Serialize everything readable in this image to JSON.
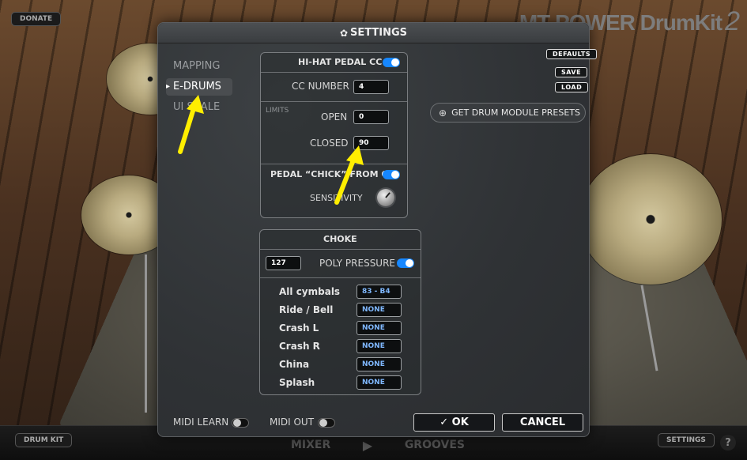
{
  "app": {
    "logo": "MT POWER DrumKit",
    "logo_version": "2",
    "donate_label": "DONATE",
    "drum_kit_label": "DRUM KIT",
    "settings_label": "SETTINGS",
    "mixer_label": "MIXER",
    "grooves_label": "GROOVES",
    "help_label": "?"
  },
  "dialog": {
    "title": "SETTINGS",
    "nav": [
      {
        "label": "MAPPING",
        "active": false
      },
      {
        "label": "E-DRUMS",
        "active": true
      },
      {
        "label": "UI SCALE",
        "active": false
      }
    ],
    "defaults_label": "DEFAULTS",
    "save_label": "SAVE",
    "load_label": "LOAD",
    "preset_button_label": "GET DRUM MODULE PRESETS",
    "hihat": {
      "title": "HI-HAT PEDAL CC",
      "enabled": true,
      "cc_number_label": "CC NUMBER",
      "cc_number_value": "4",
      "limits_label": "LIMITS",
      "open_label": "OPEN",
      "open_value": "0",
      "closed_label": "CLOSED",
      "closed_value": "90",
      "pedal_chick_label": "PEDAL “CHICK” FROM CC",
      "pedal_chick_enabled": true,
      "sensitivity_label": "SENSITIVITY"
    },
    "choke": {
      "title": "CHOKE",
      "value": "127",
      "poly_pressure_label": "POLY PRESSURE",
      "poly_pressure_enabled": true,
      "rows": [
        {
          "label": "All  cymbals",
          "value": "83 - B4"
        },
        {
          "label": "Ride / Bell",
          "value": "NONE"
        },
        {
          "label": "Crash L",
          "value": "NONE"
        },
        {
          "label": "Crash R",
          "value": "NONE"
        },
        {
          "label": "China",
          "value": "NONE"
        },
        {
          "label": "Splash",
          "value": "NONE"
        }
      ]
    },
    "midi_learn_label": "MIDI LEARN",
    "midi_learn_enabled": false,
    "midi_out_label": "MIDI OUT",
    "midi_out_enabled": false,
    "ok_label": "✓ OK",
    "cancel_label": "CANCEL"
  },
  "colors": {
    "accent": "#1687ff",
    "annotation_arrow": "#ffee00"
  }
}
